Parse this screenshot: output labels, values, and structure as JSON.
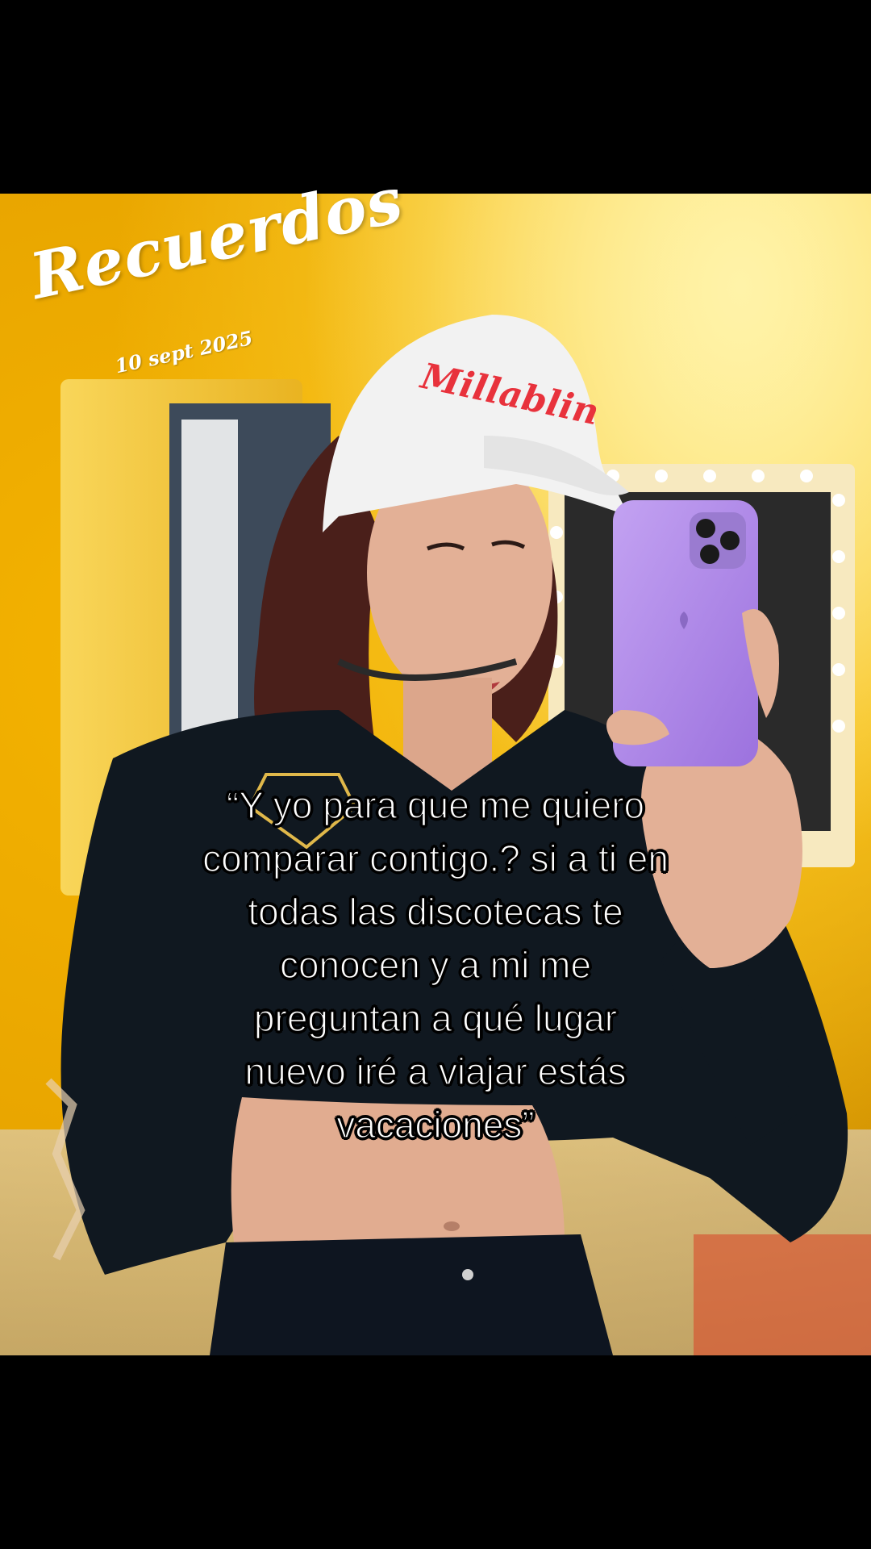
{
  "sticker": {
    "title": "Recuerdos",
    "date": "10 sept 2025"
  },
  "caption": {
    "lines": [
      "“Y yo para que me quiero",
      "comparar contigo.? si a ti en",
      "todas las discotecas te",
      "conocen y a mi me",
      "preguntan a qué lugar",
      "nuevo iré a viajar estás",
      "vacaciones”"
    ]
  },
  "photo": {
    "cap_text": "Millablin",
    "colors": {
      "wall": "#f5b400",
      "hoodie": "#101820",
      "phone_case": "#b48ee8",
      "cap": "#f2f2f2",
      "cap_logo": "#e8323c",
      "letterbox": "#000000"
    }
  }
}
